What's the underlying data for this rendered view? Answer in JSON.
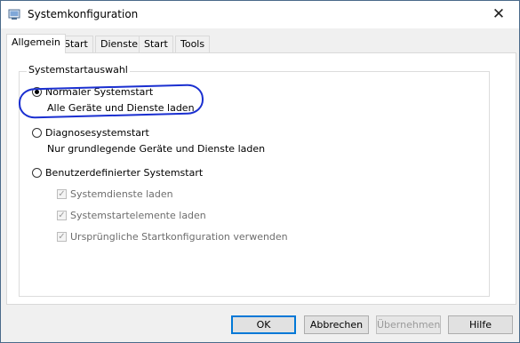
{
  "window": {
    "title": "Systemkonfiguration",
    "close_glyph": "✕"
  },
  "tabs": [
    {
      "label": "Allgemein",
      "active": true
    },
    {
      "label": "Start"
    },
    {
      "label": "Dienste"
    },
    {
      "label": "Start"
    },
    {
      "label": "Tools"
    }
  ],
  "group": {
    "title": "Systemstartauswahl"
  },
  "options": {
    "normal": {
      "label": "Normaler Systemstart",
      "desc": "Alle Geräte und Dienste laden",
      "checked": true
    },
    "diagnose": {
      "label": "Diagnosesystemstart",
      "desc": "Nur grundlegende Geräte und Dienste laden",
      "checked": false
    },
    "custom": {
      "label": "Benutzerdefinierter Systemstart",
      "checked": false
    }
  },
  "custom_checks": [
    {
      "label": "Systemdienste laden",
      "checked": true,
      "enabled": false
    },
    {
      "label": "Systemstartelemente laden",
      "checked": true,
      "enabled": false
    },
    {
      "label": "Ursprüngliche Startkonfiguration verwenden",
      "checked": true,
      "enabled": false
    }
  ],
  "buttons": {
    "ok": "OK",
    "cancel": "Abbrechen",
    "apply": "Übernehmen",
    "help": "Hilfe"
  },
  "colors": {
    "annotation": "#1a2fd0",
    "default_button_border": "#0078d7"
  }
}
